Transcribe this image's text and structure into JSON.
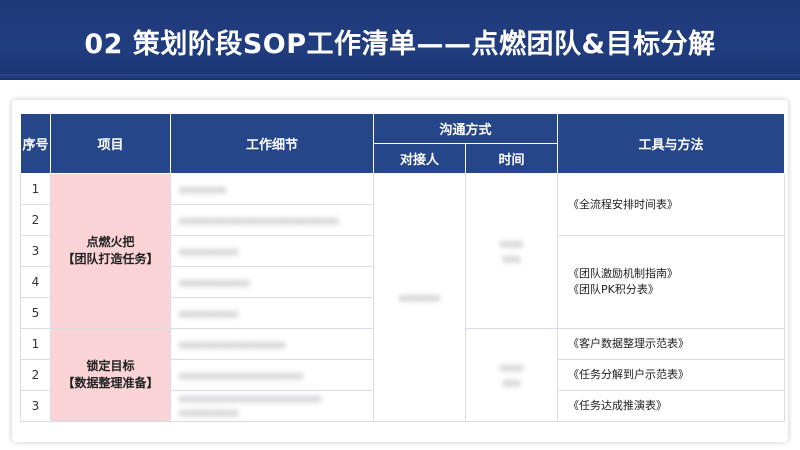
{
  "title": "02 策划阶段SOP工作清单——点燃团队&目标分解",
  "table": {
    "headers": {
      "seq": "序号",
      "item": "项目",
      "detail": "工作细节",
      "comm": "沟通方式",
      "contact": "对接人",
      "time": "时间",
      "tools": "工具与方法"
    },
    "groups": [
      {
        "item_line1": "点燃火把",
        "item_line2": "【团队打造任务】",
        "rows": [
          "1",
          "2",
          "3",
          "4",
          "5"
        ],
        "details": [
          "xxxxxxxx",
          "xxxxxxxxxxxxxxxxxxxxxxxxxxx",
          "xxxxxxxxxx",
          "xxxxxxxxxxxx",
          "xxxxxxxxxx"
        ],
        "contact": "xxxxxxx",
        "time": [
          "xxxx",
          "xxx"
        ],
        "tools": [
          "《全流程安排时间表》",
          "《团队激励机制指南》",
          "《团队PK积分表》"
        ]
      },
      {
        "item_line1": "锁定目标",
        "item_line2": "【数据整理准备】",
        "rows": [
          "1",
          "2",
          "3"
        ],
        "details": [
          "xxxxxxxxxxxxxxxxxx",
          "xxxxxxxxxxxxxxxxxxxxx",
          "xxxxxxxxxxxxxxxxxxxxxxxx",
          "xxxxxxxxxx"
        ],
        "time": [
          "xxxx",
          "xxx"
        ],
        "tools": [
          "《客户数据整理示范表》",
          "《任务分解到户示范表》",
          "《任务达成推演表》"
        ]
      }
    ]
  }
}
